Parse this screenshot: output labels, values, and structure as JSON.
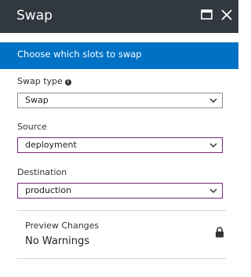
{
  "header": {
    "title": "Swap",
    "maximize_icon": "maximize-icon",
    "close_icon": "close-icon",
    "background": "#32383f"
  },
  "info_banner": {
    "text": "Choose which slots to swap",
    "background": "#0072c6"
  },
  "form": {
    "swap_type": {
      "label": "Swap type",
      "info_icon": "info-icon",
      "value": "Swap"
    },
    "source": {
      "label": "Source",
      "value": "deployment"
    },
    "destination": {
      "label": "Destination",
      "value": "production"
    }
  },
  "preview": {
    "label": "Preview Changes",
    "value": "No Warnings",
    "icon": "lock-icon"
  },
  "colors": {
    "focus_border": "#7a2875",
    "accent": "#0072c6"
  }
}
